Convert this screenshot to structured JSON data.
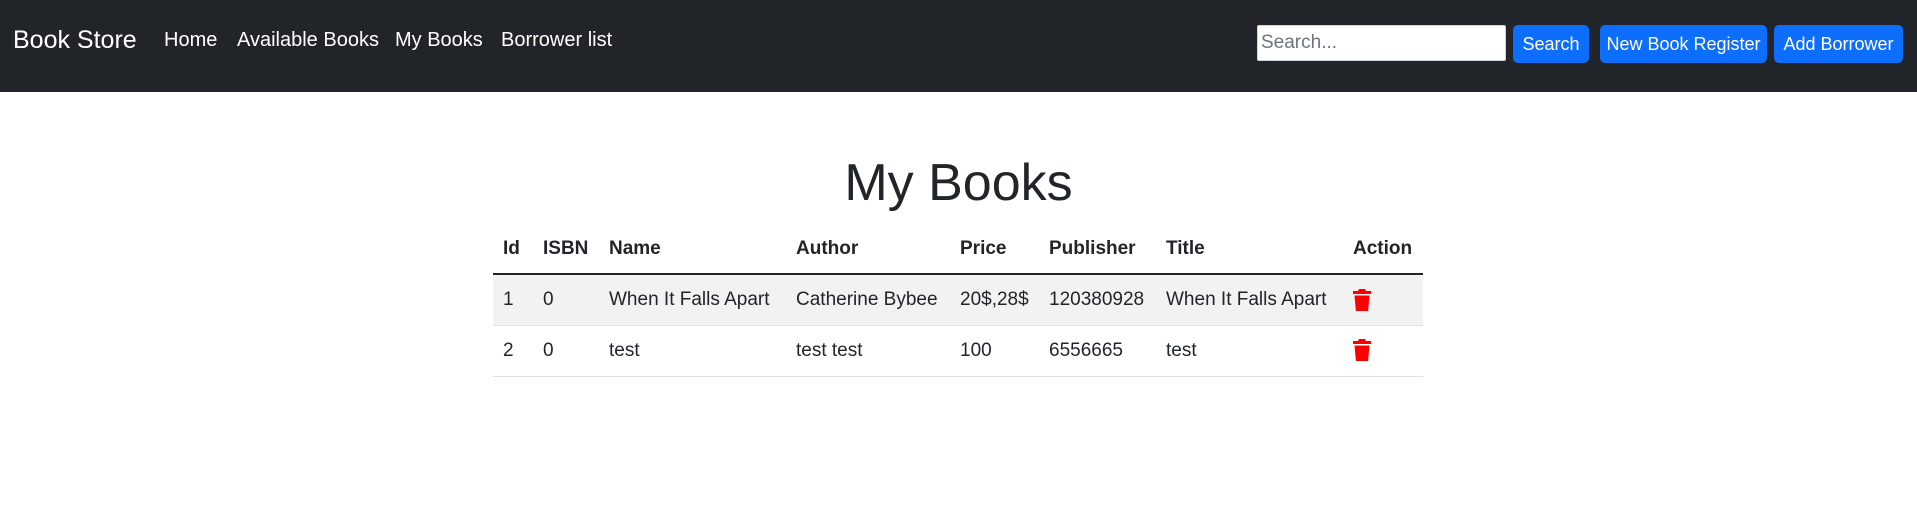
{
  "navbar": {
    "brand": "Book Store",
    "links": [
      "Home",
      "Available Books",
      "My Books",
      "Borrower list"
    ],
    "search": {
      "placeholder": "Search...",
      "value": ""
    },
    "search_button": "Search",
    "new_book_button": "New Book Register",
    "add_borrower_button": "Add Borrower"
  },
  "main": {
    "title": "My Books",
    "table": {
      "headers": [
        "Id",
        "ISBN",
        "Name",
        "Author",
        "Price",
        "Publisher",
        "Title",
        "Action"
      ],
      "rows": [
        [
          "1",
          "0",
          "When It Falls Apart",
          "Catherine Bybee",
          "20$,28$",
          "120380928",
          "When It Falls Apart"
        ],
        [
          "2",
          "0",
          "test",
          "test test",
          "100",
          "6556665",
          "test"
        ]
      ]
    },
    "action_icon": "trash-icon"
  },
  "colors": {
    "navbar_bg": "#212529",
    "primary_button": "#0d6efd",
    "delete_icon": "#ff0000",
    "striped_row": "#f2f2f2"
  }
}
